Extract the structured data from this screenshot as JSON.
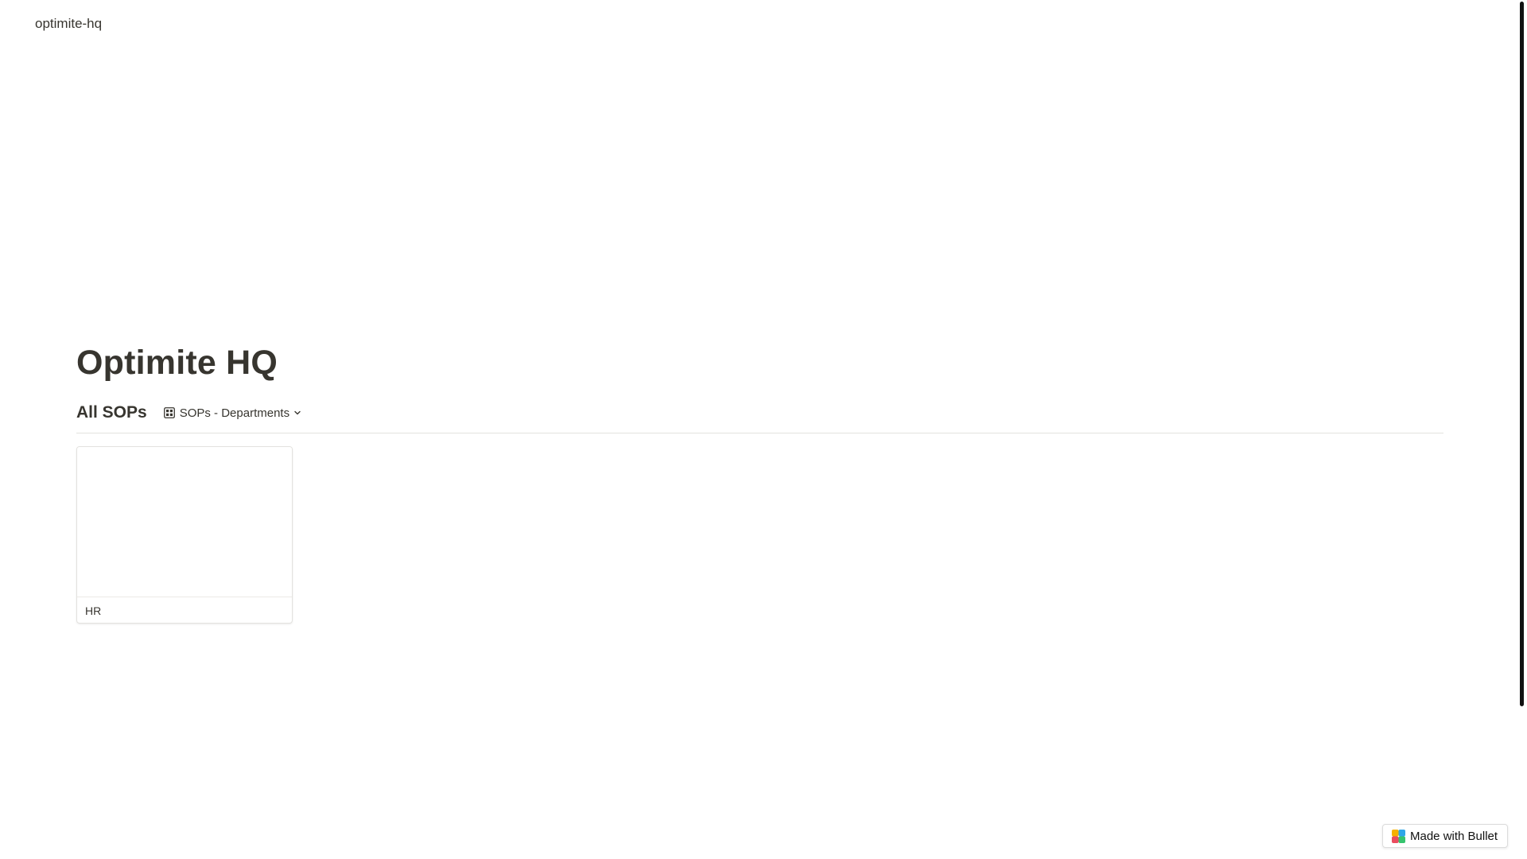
{
  "header": {
    "site_name": "optimite-hq"
  },
  "page": {
    "title": "Optimite HQ"
  },
  "collection": {
    "title": "All SOPs",
    "view_icon": "gallery-grid-icon",
    "view_name": "SOPs - Departments",
    "dropdown_icon": "chevron-down-icon",
    "cards": [
      {
        "title": "HR"
      }
    ]
  },
  "badge": {
    "label": "Made with Bullet",
    "logo_icon": "bullet-logo-icon",
    "logo_colors": [
      "#f5b100",
      "#2ea6e8",
      "#ea4c5f",
      "#36c46e"
    ]
  }
}
